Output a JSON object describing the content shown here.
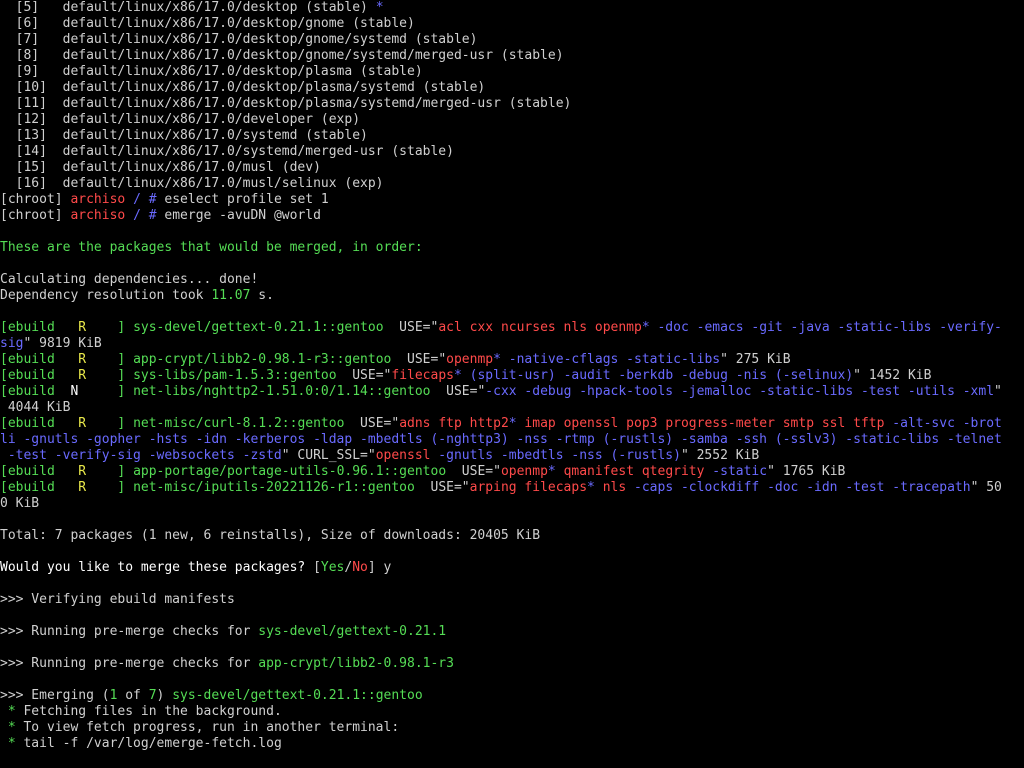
{
  "terminal": {
    "lines": [
      [
        [
          "  [5]   default/linux/x86/17.0/desktop (stable) ",
          "w"
        ],
        [
          "*",
          "b"
        ]
      ],
      [
        [
          "  [6]   default/linux/x86/17.0/desktop/gnome (stable)",
          "w"
        ]
      ],
      [
        [
          "  [7]   default/linux/x86/17.0/desktop/gnome/systemd (stable)",
          "w"
        ]
      ],
      [
        [
          "  [8]   default/linux/x86/17.0/desktop/gnome/systemd/merged-usr (stable)",
          "w"
        ]
      ],
      [
        [
          "  [9]   default/linux/x86/17.0/desktop/plasma (stable)",
          "w"
        ]
      ],
      [
        [
          "  [10]  default/linux/x86/17.0/desktop/plasma/systemd (stable)",
          "w"
        ]
      ],
      [
        [
          "  [11]  default/linux/x86/17.0/desktop/plasma/systemd/merged-usr (stable)",
          "w"
        ]
      ],
      [
        [
          "  [12]  default/linux/x86/17.0/developer (exp)",
          "w"
        ]
      ],
      [
        [
          "  [13]  default/linux/x86/17.0/systemd (stable)",
          "w"
        ]
      ],
      [
        [
          "  [14]  default/linux/x86/17.0/systemd/merged-usr (stable)",
          "w"
        ]
      ],
      [
        [
          "  [15]  default/linux/x86/17.0/musl (dev)",
          "w"
        ]
      ],
      [
        [
          "  [16]  default/linux/x86/17.0/musl/selinux (exp)",
          "w"
        ]
      ],
      [
        [
          "[chroot] ",
          "w"
        ],
        [
          "archiso",
          "r"
        ],
        [
          " / # ",
          "b"
        ],
        [
          "eselect profile set 1",
          "w"
        ]
      ],
      [
        [
          "[chroot] ",
          "w"
        ],
        [
          "archiso",
          "r"
        ],
        [
          " / # ",
          "b"
        ],
        [
          "emerge -avuDN @world",
          "w"
        ]
      ],
      [
        [
          "",
          ""
        ]
      ],
      [
        [
          "These are the packages that would be merged, in order:",
          "g"
        ]
      ],
      [
        [
          "",
          ""
        ]
      ],
      [
        [
          "Calculating dependencies... done!",
          "w"
        ]
      ],
      [
        [
          "Dependency resolution took ",
          "w"
        ],
        [
          "11.07",
          "g"
        ],
        [
          " s.",
          "w"
        ]
      ],
      [
        [
          "",
          ""
        ]
      ],
      [
        [
          "[ebuild   ",
          "g"
        ],
        [
          "R",
          "y"
        ],
        [
          "    ] ",
          "g"
        ],
        [
          "sys-devel/gettext-0.21.1::gentoo",
          "g"
        ],
        [
          "  USE=\"",
          "w"
        ],
        [
          "acl cxx ncurses nls openmp",
          "r"
        ],
        [
          "*",
          "b"
        ],
        [
          " -doc -emacs -git -java -static-libs -verify-",
          "b"
        ]
      ],
      [
        [
          "sig",
          "b"
        ],
        [
          "\" 9819 KiB",
          "w"
        ]
      ],
      [
        [
          "[ebuild   ",
          "g"
        ],
        [
          "R",
          "y"
        ],
        [
          "    ] ",
          "g"
        ],
        [
          "app-crypt/libb2-0.98.1-r3::gentoo",
          "g"
        ],
        [
          "  USE=\"",
          "w"
        ],
        [
          "openmp",
          "r"
        ],
        [
          "*",
          "b"
        ],
        [
          " -native-cflags -static-libs",
          "b"
        ],
        [
          "\" 275 KiB",
          "w"
        ]
      ],
      [
        [
          "[ebuild   ",
          "g"
        ],
        [
          "R",
          "y"
        ],
        [
          "    ] ",
          "g"
        ],
        [
          "sys-libs/pam-1.5.3::gentoo",
          "g"
        ],
        [
          "  USE=\"",
          "w"
        ],
        [
          "filecaps",
          "r"
        ],
        [
          "*",
          "b"
        ],
        [
          " (split-usr) -audit -berkdb -debug -nis (-selinux)",
          "b"
        ],
        [
          "\" 1452 KiB",
          "w"
        ]
      ],
      [
        [
          "[ebuild  ",
          "g"
        ],
        [
          "N",
          "wb"
        ],
        [
          "     ] ",
          "g"
        ],
        [
          "net-libs/nghttp2-1.51.0:0/1.14::gentoo",
          "g"
        ],
        [
          "  USE=\"",
          "w"
        ],
        [
          "-cxx -debug -hpack-tools -jemalloc -static-libs -test -utils -xml",
          "b"
        ],
        [
          "\"",
          "w"
        ]
      ],
      [
        [
          " 4044 KiB",
          "w"
        ]
      ],
      [
        [
          "[ebuild   ",
          "g"
        ],
        [
          "R",
          "y"
        ],
        [
          "    ] ",
          "g"
        ],
        [
          "net-misc/curl-8.1.2::gentoo",
          "g"
        ],
        [
          "  USE=\"",
          "w"
        ],
        [
          "adns ftp http2",
          "r"
        ],
        [
          "*",
          "b"
        ],
        [
          " imap openssl pop3 progress-meter smtp ssl tftp",
          "r"
        ],
        [
          " -alt-svc -brot",
          "b"
        ]
      ],
      [
        [
          "li -gnutls -gopher -hsts -idn -kerberos -ldap -mbedtls (-nghttp3) -nss -rtmp (-rustls) -samba -ssh (-sslv3) -static-libs -telnet",
          "b"
        ]
      ],
      [
        [
          " -test -verify-sig -websockets -zstd",
          "b"
        ],
        [
          "\" CURL_SSL=\"",
          "w"
        ],
        [
          "openssl",
          "r"
        ],
        [
          " -gnutls -mbedtls -nss (-rustls)",
          "b"
        ],
        [
          "\" 2552 KiB",
          "w"
        ]
      ],
      [
        [
          "[ebuild   ",
          "g"
        ],
        [
          "R",
          "y"
        ],
        [
          "    ] ",
          "g"
        ],
        [
          "app-portage/portage-utils-0.96.1::gentoo",
          "g"
        ],
        [
          "  USE=\"",
          "w"
        ],
        [
          "openmp",
          "r"
        ],
        [
          "*",
          "b"
        ],
        [
          " qmanifest qtegrity",
          "r"
        ],
        [
          " -static",
          "b"
        ],
        [
          "\" 1765 KiB",
          "w"
        ]
      ],
      [
        [
          "[ebuild   ",
          "g"
        ],
        [
          "R",
          "y"
        ],
        [
          "    ] ",
          "g"
        ],
        [
          "net-misc/iputils-20221126-r1::gentoo",
          "g"
        ],
        [
          "  USE=\"",
          "w"
        ],
        [
          "arping filecaps",
          "r"
        ],
        [
          "*",
          "b"
        ],
        [
          " nls",
          "r"
        ],
        [
          " -caps -clockdiff -doc -idn -test -tracepath",
          "b"
        ],
        [
          "\" 50",
          "w"
        ]
      ],
      [
        [
          "0 KiB",
          "w"
        ]
      ],
      [
        [
          "",
          ""
        ]
      ],
      [
        [
          "Total: 7 packages (1 new, 6 reinstalls), Size of downloads: 20405 KiB",
          "w"
        ]
      ],
      [
        [
          "",
          ""
        ]
      ],
      [
        [
          "Would you like to merge these packages? ",
          "wb"
        ],
        [
          "[",
          "w"
        ],
        [
          "Yes",
          "g"
        ],
        [
          "/",
          "w"
        ],
        [
          "No",
          "r"
        ],
        [
          "] y",
          "w"
        ]
      ],
      [
        [
          "",
          ""
        ]
      ],
      [
        [
          ">>> Verifying ebuild manifests",
          "w"
        ]
      ],
      [
        [
          "",
          ""
        ]
      ],
      [
        [
          ">>> Running pre-merge checks for ",
          "w"
        ],
        [
          "sys-devel/gettext-0.21.1",
          "g"
        ]
      ],
      [
        [
          "",
          ""
        ]
      ],
      [
        [
          ">>> Running pre-merge checks for ",
          "w"
        ],
        [
          "app-crypt/libb2-0.98.1-r3",
          "g"
        ]
      ],
      [
        [
          "",
          ""
        ]
      ],
      [
        [
          ">>> Emerging (",
          "w"
        ],
        [
          "1",
          "g"
        ],
        [
          " of ",
          "w"
        ],
        [
          "7",
          "g"
        ],
        [
          ") ",
          "w"
        ],
        [
          "sys-devel/gettext-0.21.1::gentoo",
          "g"
        ]
      ],
      [
        [
          " * ",
          "g"
        ],
        [
          "Fetching files in the background.",
          "w"
        ]
      ],
      [
        [
          " * ",
          "g"
        ],
        [
          "To view fetch progress, run in another terminal:",
          "w"
        ]
      ],
      [
        [
          " * ",
          "g"
        ],
        [
          "tail -f /var/log/emerge-fetch.log",
          "w"
        ]
      ]
    ]
  }
}
